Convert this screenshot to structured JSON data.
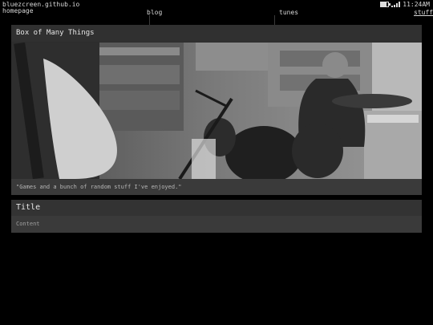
{
  "status_bar": {
    "site": "bluezcreen.github.io",
    "time": "11:24AM",
    "battery_level": 0.75
  },
  "nav": {
    "items": [
      {
        "label": "homepage",
        "active": false
      },
      {
        "label": "blog",
        "active": false
      },
      {
        "label": "tunes",
        "active": false
      },
      {
        "label": "stuff",
        "active": true
      }
    ]
  },
  "main_card": {
    "title": "Box of Many Things",
    "image_desc_icon": "photo-icon",
    "caption": "\"Games and a bunch of random stuff I've enjoyed.\""
  },
  "second_card": {
    "title": "Title",
    "content": "Content"
  }
}
